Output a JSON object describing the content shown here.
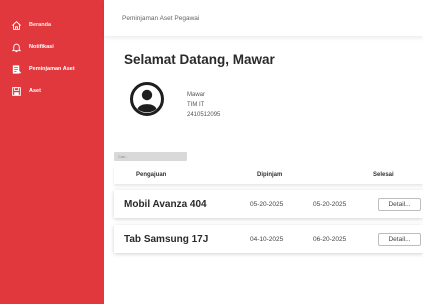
{
  "sidebar": {
    "items": [
      {
        "label": "Beranda",
        "icon": "home-icon"
      },
      {
        "label": "Notifikasi",
        "icon": "bell-icon"
      },
      {
        "label": "Peminjaman Aset",
        "icon": "document-icon"
      },
      {
        "label": "Aset",
        "icon": "save-icon"
      }
    ]
  },
  "header": {
    "title": "Peminjaman Aset Pegawai"
  },
  "main": {
    "welcome": "Selamat Datang, Mawar",
    "profile": {
      "name": "Mawar",
      "team": "TIM IT",
      "id": "2410512095"
    },
    "search": {
      "placeholder": "Cari..."
    },
    "table": {
      "columns": [
        "Pengajuan",
        "Dipinjam",
        "Selesai"
      ],
      "rows": [
        {
          "name": "Mobil Avanza 404",
          "borrowed": "05-20-2025",
          "finished": "05-20-2025",
          "action": "Detail..."
        },
        {
          "name": "Tab Samsung 17J",
          "borrowed": "04-10-2025",
          "finished": "06-20-2025",
          "action": "Detail..."
        }
      ]
    }
  },
  "colors": {
    "sidebar": "#e0383d",
    "text": "#2a2a2a"
  }
}
